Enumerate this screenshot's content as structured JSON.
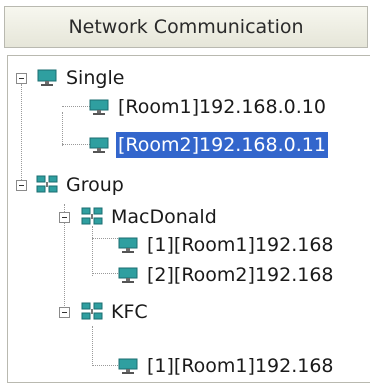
{
  "panel": {
    "title": "Network Communication"
  },
  "tree": {
    "single": {
      "label": "Single",
      "children": [
        {
          "room": "[Room1]",
          "ip": "192.168.0.10"
        },
        {
          "room": "[Room2]",
          "ip": "192.168.0.11",
          "selected": true
        }
      ]
    },
    "group": {
      "label": "Group",
      "children": [
        {
          "label": "MacDonald",
          "children": [
            {
              "text": "[1][Room1]",
              "ip": "192.168"
            },
            {
              "text": "[2][Room2]",
              "ip": "192.168"
            }
          ]
        },
        {
          "label": "KFC",
          "children": [
            {
              "text": "[1][Room1]",
              "ip": "192.168"
            }
          ]
        }
      ]
    }
  },
  "colors": {
    "selection": "#3366cc",
    "monitor_icon": "#2f9fa0"
  },
  "icons": {
    "expanded": "minus-box-icon",
    "computer": "monitor-icon",
    "group": "network-group-icon"
  }
}
